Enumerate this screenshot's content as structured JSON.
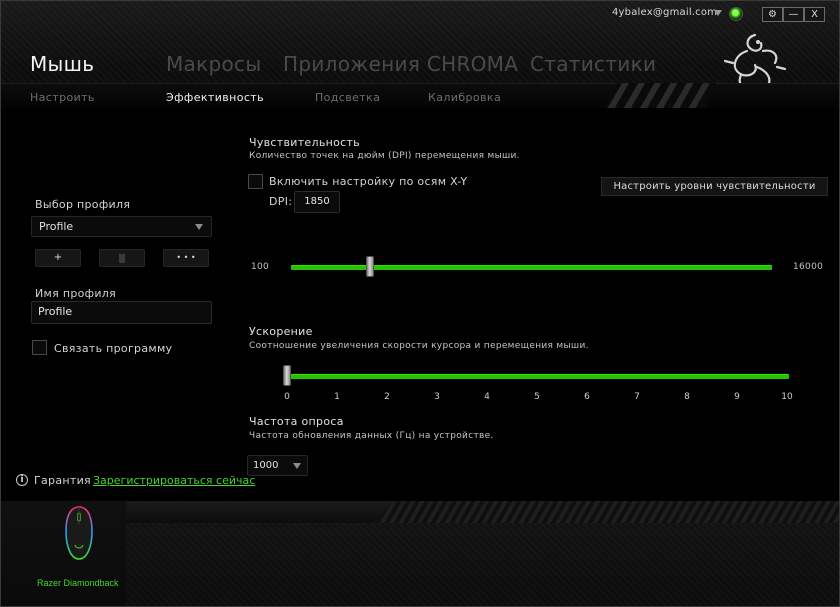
{
  "header": {
    "account_email": "4ybalex@gmail.com",
    "window_buttons": {
      "settings": "⚙",
      "minimize": "—",
      "close": "X"
    },
    "main_tabs": [
      "Мышь",
      "Макросы",
      "Приложения CHROMA",
      "Статистики"
    ],
    "sub_tabs": [
      "Настроить",
      "Эффективность",
      "Подсветка",
      "Калибровка"
    ]
  },
  "left_panel": {
    "profile_select_label": "Выбор профиля",
    "profile_value": "Profile",
    "add_label": "+",
    "delete_icon": "trash-icon",
    "more_label": "• • •",
    "profile_name_label": "Имя профиля",
    "profile_name_value": "Profile",
    "link_program_label": "Связать программу",
    "warranty_label": "Гарантия",
    "register_link": "Зарегистрироваться сейчас"
  },
  "sensitivity": {
    "title": "Чувствительность",
    "description": "Количество точек на дюйм (DPI) перемещения мыши.",
    "xy_checkbox_label": "Включить настройку по осям X-Y",
    "dpi_label": "DPI:",
    "dpi_value": "1850",
    "levels_button": "Настроить уровни чувствительности",
    "min_label": "100",
    "max_label": "16000",
    "value": 1850,
    "min": 100,
    "max": 16000
  },
  "acceleration": {
    "title": "Ускорение",
    "description": "Соотношение увеличения скорости курсора и перемещения мыши.",
    "ticks": [
      "0",
      "1",
      "2",
      "3",
      "4",
      "5",
      "6",
      "7",
      "8",
      "9",
      "10"
    ],
    "value": 0
  },
  "polling": {
    "title": "Частота опроса",
    "description": "Частота обновления данных (Гц) на устройстве.",
    "value": "1000"
  },
  "footer": {
    "device_name": "Razer Diamondback"
  },
  "colors": {
    "accent": "#44d62c",
    "track": "#22c400",
    "background": "#000000"
  }
}
